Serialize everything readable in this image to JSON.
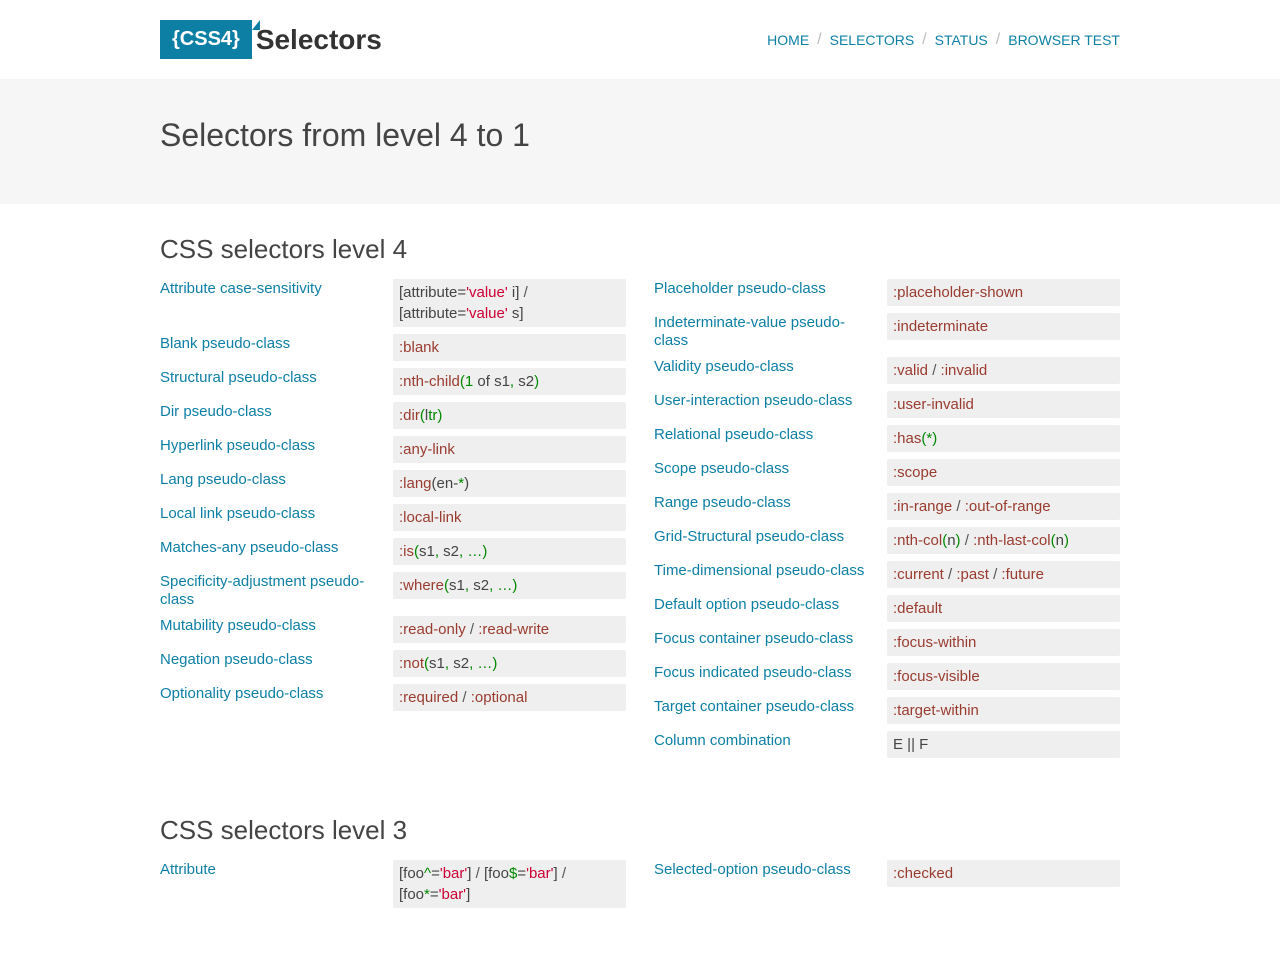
{
  "logo": {
    "badge": "{CSS4}",
    "text": "Selectors"
  },
  "nav": [
    "HOME",
    "SELECTORS",
    "STATUS",
    "BROWSER TEST"
  ],
  "hero": "Selectors from level 4 to 1",
  "sections": {
    "lvl4": {
      "title": "CSS selectors level 4",
      "left": [
        {
          "label": "Attribute case-sensitivity",
          "code": [
            [
              [
                "c-punct",
                "["
              ],
              [
                "c-plain",
                "attribute"
              ],
              [
                "c-punct",
                "="
              ],
              [
                "c-str",
                "'value'"
              ],
              [
                "c-plain",
                " i"
              ],
              [
                "c-punct",
                "]"
              ],
              [
                "divider",
                " / "
              ]
            ],
            [
              [
                "c-punct",
                "["
              ],
              [
                "c-plain",
                "attribute"
              ],
              [
                "c-punct",
                "="
              ],
              [
                "c-str",
                "'value'"
              ],
              [
                "c-plain",
                " s"
              ],
              [
                "c-punct",
                "]"
              ]
            ]
          ]
        },
        {
          "label": "Blank pseudo-class",
          "code": [
            [
              [
                "c-sel",
                ":blank"
              ]
            ]
          ]
        },
        {
          "label": "Structural pseudo-class",
          "code": [
            [
              [
                "c-sel",
                ":nth-child"
              ],
              [
                "c-num",
                "("
              ],
              [
                "c-num",
                "1"
              ],
              [
                "c-plain",
                " of s1"
              ],
              [
                "c-num",
                ","
              ],
              [
                "c-plain",
                " s2"
              ],
              [
                "c-num",
                ")"
              ]
            ]
          ]
        },
        {
          "label": "Dir pseudo-class",
          "code": [
            [
              [
                "c-sel",
                ":dir"
              ],
              [
                "c-num",
                "("
              ],
              [
                "c-plain",
                "l"
              ],
              [
                "c-num",
                "tr"
              ],
              [
                "c-num",
                ")"
              ]
            ]
          ]
        },
        {
          "label": "Hyperlink pseudo-class",
          "code": [
            [
              [
                "c-sel",
                ":any-link"
              ]
            ]
          ]
        },
        {
          "label": "Lang pseudo-class",
          "code": [
            [
              [
                "c-sel",
                ":lang"
              ],
              [
                "c-plain",
                "(en-"
              ],
              [
                "c-num",
                "*"
              ],
              [
                "c-plain",
                ")"
              ]
            ]
          ]
        },
        {
          "label": "Local link pseudo-class",
          "code": [
            [
              [
                "c-sel",
                ":local-link"
              ]
            ]
          ]
        },
        {
          "label": "Matches-any pseudo-class",
          "code": [
            [
              [
                "c-sel",
                ":is"
              ],
              [
                "c-num",
                "("
              ],
              [
                "c-plain",
                "s1"
              ],
              [
                "c-num",
                ","
              ],
              [
                "c-plain",
                " s2"
              ],
              [
                "c-num",
                ","
              ],
              [
                "c-plain",
                " "
              ],
              [
                "c-num",
                "…"
              ],
              [
                "c-num",
                ")"
              ]
            ]
          ]
        },
        {
          "label": "Specificity-adjustment pseudo-class",
          "code": [
            [
              [
                "c-sel",
                ":where"
              ],
              [
                "c-num",
                "("
              ],
              [
                "c-plain",
                "s1"
              ],
              [
                "c-num",
                ","
              ],
              [
                "c-plain",
                " s2"
              ],
              [
                "c-num",
                ","
              ],
              [
                "c-plain",
                " "
              ],
              [
                "c-num",
                "…"
              ],
              [
                "c-num",
                ")"
              ]
            ]
          ]
        },
        {
          "label": "Mutability pseudo-class",
          "code": [
            [
              [
                "c-sel",
                ":read-only"
              ],
              [
                "divider",
                " / "
              ],
              [
                "c-sel",
                ":read-write"
              ]
            ]
          ]
        },
        {
          "label": "Negation pseudo-class",
          "code": [
            [
              [
                "c-sel",
                ":not"
              ],
              [
                "c-num",
                "("
              ],
              [
                "c-plain",
                "s1"
              ],
              [
                "c-num",
                ","
              ],
              [
                "c-plain",
                " s2"
              ],
              [
                "c-num",
                ","
              ],
              [
                "c-plain",
                " "
              ],
              [
                "c-num",
                "…"
              ],
              [
                "c-num",
                ")"
              ]
            ]
          ]
        },
        {
          "label": "Optionality pseudo-class",
          "code": [
            [
              [
                "c-sel",
                ":required"
              ],
              [
                "divider",
                " / "
              ],
              [
                "c-sel",
                ":optional"
              ]
            ]
          ]
        }
      ],
      "right": [
        {
          "label": "Placeholder pseudo-class",
          "code": [
            [
              [
                "c-sel",
                ":placeholder-shown"
              ]
            ]
          ]
        },
        {
          "label": "Indeterminate-value pseudo-class",
          "code": [
            [
              [
                "c-sel",
                ":indeterminate"
              ]
            ]
          ]
        },
        {
          "label": "Validity pseudo-class",
          "code": [
            [
              [
                "c-sel",
                ":valid"
              ],
              [
                "divider",
                " / "
              ],
              [
                "c-sel",
                ":invalid"
              ]
            ]
          ]
        },
        {
          "label": "User-interaction pseudo-class",
          "code": [
            [
              [
                "c-sel",
                ":user-invalid"
              ]
            ]
          ]
        },
        {
          "label": "Relational pseudo-class",
          "code": [
            [
              [
                "c-sel",
                ":has"
              ],
              [
                "c-num",
                "(*)"
              ]
            ]
          ]
        },
        {
          "label": "Scope pseudo-class",
          "code": [
            [
              [
                "c-sel",
                ":scope"
              ]
            ]
          ]
        },
        {
          "label": "Range pseudo-class",
          "code": [
            [
              [
                "c-sel",
                ":in-range"
              ],
              [
                "divider",
                " / "
              ],
              [
                "c-sel",
                ":out-of-range"
              ]
            ]
          ]
        },
        {
          "label": "Grid-Structural pseudo-class",
          "code": [
            [
              [
                "c-sel",
                ":nth-col"
              ],
              [
                "c-num",
                "("
              ],
              [
                "c-plain",
                "n"
              ],
              [
                "c-num",
                ")"
              ],
              [
                "divider",
                " / "
              ],
              [
                "c-sel",
                ":nth-last-col"
              ],
              [
                "c-num",
                "("
              ],
              [
                "c-plain",
                "n"
              ],
              [
                "c-num",
                ")"
              ]
            ]
          ]
        },
        {
          "label": "Time-dimensional pseudo-class",
          "code": [
            [
              [
                "c-sel",
                ":current"
              ],
              [
                "divider",
                " / "
              ],
              [
                "c-sel",
                ":past"
              ],
              [
                "divider",
                " / "
              ],
              [
                "c-sel",
                ":future"
              ]
            ]
          ]
        },
        {
          "label": "Default option pseudo-class",
          "code": [
            [
              [
                "c-sel",
                ":default"
              ]
            ]
          ]
        },
        {
          "label": "Focus container pseudo-class",
          "code": [
            [
              [
                "c-sel",
                ":focus-within"
              ]
            ]
          ]
        },
        {
          "label": "Focus indicated pseudo-class",
          "code": [
            [
              [
                "c-sel",
                ":focus-visible"
              ]
            ]
          ]
        },
        {
          "label": "Target container pseudo-class",
          "code": [
            [
              [
                "c-sel",
                ":target-within"
              ]
            ]
          ]
        },
        {
          "label": "Column combination",
          "code": [
            [
              [
                "c-plain",
                "E || F"
              ]
            ]
          ]
        }
      ]
    },
    "lvl3": {
      "title": "CSS selectors level 3",
      "left": [
        {
          "label": "Attribute",
          "code": [
            [
              [
                "c-punct",
                "["
              ],
              [
                "c-plain",
                "foo"
              ],
              [
                "c-num",
                "^"
              ],
              [
                "c-punct",
                "="
              ],
              [
                "c-str",
                "'bar'"
              ],
              [
                "c-punct",
                "]"
              ],
              [
                "divider",
                " / "
              ],
              [
                "c-punct",
                "["
              ],
              [
                "c-plain",
                "foo"
              ],
              [
                "c-num",
                "$"
              ],
              [
                "c-punct",
                "="
              ],
              [
                "c-str",
                "'bar'"
              ],
              [
                "c-punct",
                "]"
              ],
              [
                "divider",
                " /"
              ]
            ],
            [
              [
                "c-punct",
                "["
              ],
              [
                "c-plain",
                "foo"
              ],
              [
                "c-num",
                "*"
              ],
              [
                "c-punct",
                "="
              ],
              [
                "c-str",
                "'bar'"
              ],
              [
                "c-punct",
                "]"
              ]
            ]
          ]
        }
      ],
      "right": [
        {
          "label": "Selected-option pseudo-class",
          "code": [
            [
              [
                "c-sel",
                ":checked"
              ]
            ]
          ]
        }
      ]
    }
  }
}
